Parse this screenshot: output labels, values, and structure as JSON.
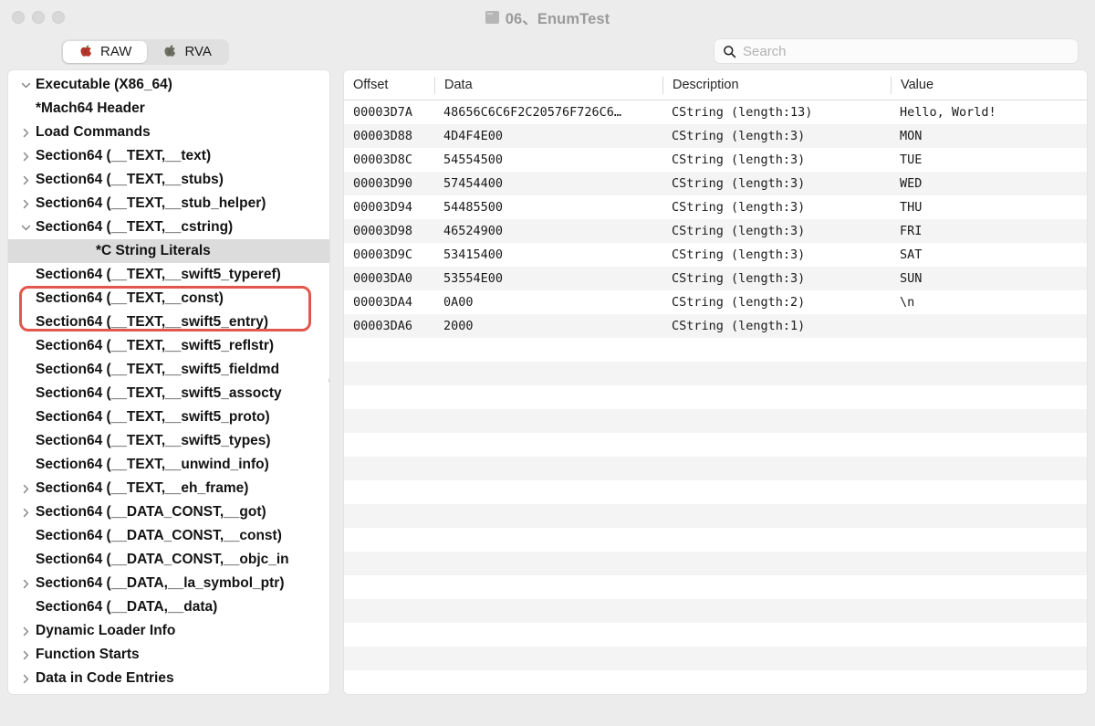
{
  "window": {
    "title": "06、EnumTest",
    "doc_icon": "document-icon",
    "traffic_lights": [
      "close-button",
      "minimize-button",
      "zoom-button"
    ]
  },
  "toolbar": {
    "segments": [
      {
        "label": "RAW",
        "icon": "apple-icon-red",
        "active": true
      },
      {
        "label": "RVA",
        "icon": "apple-icon-gray",
        "active": false
      }
    ],
    "search": {
      "icon": "search-icon",
      "placeholder": "Search",
      "value": ""
    }
  },
  "sidebar": {
    "items": [
      {
        "label": "Executable  (X86_64)",
        "depth": 0,
        "twisty": "down",
        "selected": false
      },
      {
        "label": "*Mach64 Header",
        "depth": 1,
        "twisty": "none",
        "selected": false
      },
      {
        "label": "Load Commands",
        "depth": 1,
        "twisty": "right",
        "selected": false
      },
      {
        "label": "Section64 (__TEXT,__text)",
        "depth": 1,
        "twisty": "right",
        "selected": false
      },
      {
        "label": "Section64 (__TEXT,__stubs)",
        "depth": 1,
        "twisty": "right",
        "selected": false
      },
      {
        "label": "Section64 (__TEXT,__stub_helper)",
        "depth": 1,
        "twisty": "right",
        "selected": false
      },
      {
        "label": "Section64 (__TEXT,__cstring)",
        "depth": 1,
        "twisty": "down",
        "selected": false
      },
      {
        "label": "*C String Literals",
        "depth": 2,
        "twisty": "none",
        "selected": true
      },
      {
        "label": "Section64 (__TEXT,__swift5_typeref)",
        "depth": 1,
        "twisty": "none",
        "selected": false
      },
      {
        "label": "Section64 (__TEXT,__const)",
        "depth": 1,
        "twisty": "none",
        "selected": false
      },
      {
        "label": "Section64 (__TEXT,__swift5_entry)",
        "depth": 1,
        "twisty": "none",
        "selected": false
      },
      {
        "label": "Section64 (__TEXT,__swift5_reflstr)",
        "depth": 1,
        "twisty": "none",
        "selected": false
      },
      {
        "label": "Section64 (__TEXT,__swift5_fieldmd",
        "depth": 1,
        "twisty": "none",
        "selected": false
      },
      {
        "label": "Section64 (__TEXT,__swift5_assocty",
        "depth": 1,
        "twisty": "none",
        "selected": false
      },
      {
        "label": "Section64 (__TEXT,__swift5_proto)",
        "depth": 1,
        "twisty": "none",
        "selected": false
      },
      {
        "label": "Section64 (__TEXT,__swift5_types)",
        "depth": 1,
        "twisty": "none",
        "selected": false
      },
      {
        "label": "Section64 (__TEXT,__unwind_info)",
        "depth": 1,
        "twisty": "none",
        "selected": false
      },
      {
        "label": "Section64 (__TEXT,__eh_frame)",
        "depth": 1,
        "twisty": "right",
        "selected": false
      },
      {
        "label": "Section64 (__DATA_CONST,__got)",
        "depth": 1,
        "twisty": "right",
        "selected": false
      },
      {
        "label": "Section64 (__DATA_CONST,__const)",
        "depth": 1,
        "twisty": "none",
        "selected": false
      },
      {
        "label": "Section64 (__DATA_CONST,__objc_in",
        "depth": 1,
        "twisty": "none",
        "selected": false
      },
      {
        "label": "Section64 (__DATA,__la_symbol_ptr)",
        "depth": 1,
        "twisty": "right",
        "selected": false
      },
      {
        "label": "Section64 (__DATA,__data)",
        "depth": 1,
        "twisty": "none",
        "selected": false
      },
      {
        "label": "Dynamic Loader Info",
        "depth": 1,
        "twisty": "right",
        "selected": false
      },
      {
        "label": "Function Starts",
        "depth": 1,
        "twisty": "right",
        "selected": false
      },
      {
        "label": "Data in Code Entries",
        "depth": 1,
        "twisty": "right",
        "selected": false
      }
    ]
  },
  "table": {
    "columns": [
      "Offset",
      "Data",
      "Description",
      "Value"
    ],
    "rows": [
      {
        "offset": "00003D7A",
        "data": "48656C6C6F2C20576F726C6…",
        "description": "CString (length:13)",
        "value": "Hello, World!"
      },
      {
        "offset": "00003D88",
        "data": "4D4F4E00",
        "description": "CString (length:3)",
        "value": "MON"
      },
      {
        "offset": "00003D8C",
        "data": "54554500",
        "description": "CString (length:3)",
        "value": "TUE"
      },
      {
        "offset": "00003D90",
        "data": "57454400",
        "description": "CString (length:3)",
        "value": "WED"
      },
      {
        "offset": "00003D94",
        "data": "54485500",
        "description": "CString (length:3)",
        "value": "THU"
      },
      {
        "offset": "00003D98",
        "data": "46524900",
        "description": "CString (length:3)",
        "value": "FRI"
      },
      {
        "offset": "00003D9C",
        "data": "53415400",
        "description": "CString (length:3)",
        "value": "SAT"
      },
      {
        "offset": "00003DA0",
        "data": "53554E00",
        "description": "CString (length:3)",
        "value": "SUN"
      },
      {
        "offset": "00003DA4",
        "data": "0A00",
        "description": "CString (length:2)",
        "value": "\\n"
      },
      {
        "offset": "00003DA6",
        "data": "2000",
        "description": "CString (length:1)",
        "value": ""
      }
    ]
  },
  "annotations": [
    {
      "name": "sidebar-highlight",
      "color": "#e2574c",
      "target": "Section64 (__TEXT,__cstring) / *C String Literals"
    },
    {
      "name": "value-column-highlight",
      "color": "#e2574c",
      "target": "MON..SUN values"
    }
  ]
}
